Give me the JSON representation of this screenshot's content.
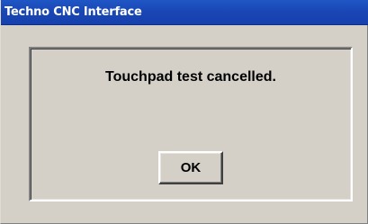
{
  "window": {
    "title": "Techno CNC Interface"
  },
  "dialog": {
    "message": "Touchpad test cancelled.",
    "ok_label": "OK"
  },
  "colors": {
    "title_bar": "#1a47b5",
    "title_text": "#ffffff",
    "background": "#d4d0c8",
    "text": "#000000"
  }
}
